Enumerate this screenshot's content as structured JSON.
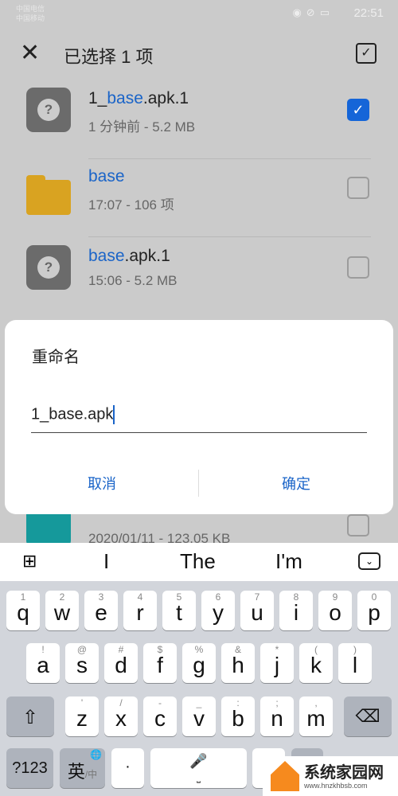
{
  "status_bar": {
    "carrier1": "中国电信",
    "carrier2": "中国移动",
    "time": "22:51",
    "icons": [
      "eye-icon",
      "mute-icon",
      "battery-icon"
    ]
  },
  "header": {
    "title": "已选择 1 项",
    "close_icon": "close-icon",
    "select_all_icon": "select-all-icon"
  },
  "files": [
    {
      "prefix": "1_",
      "highlight": "base",
      "suffix": ".apk.1",
      "meta": "1 分钟前 - 5.2 MB",
      "icon": "unknown-file-icon",
      "checked": true
    },
    {
      "prefix": "",
      "highlight": "base",
      "suffix": "",
      "meta": "17:07 - 106 项",
      "icon": "folder-icon",
      "checked": false
    },
    {
      "prefix": "",
      "highlight": "base",
      "suffix": ".apk.1",
      "meta": "15:06 - 5.2 MB",
      "icon": "unknown-file-icon",
      "checked": false
    },
    {
      "prefix": "",
      "highlight": "",
      "suffix": "",
      "meta": "2020/01/11 - 123.05 KB",
      "icon": "document-icon",
      "checked": false
    }
  ],
  "colors": {
    "accent": "#1565d8",
    "folder": "#d9a321",
    "doc": "#15999b"
  },
  "dialog": {
    "title": "重命名",
    "value": "1_base.apk",
    "cancel": "取消",
    "confirm": "确定"
  },
  "suggestions": [
    "I",
    "The",
    "I'm"
  ],
  "keyboard": {
    "row1": [
      [
        "q",
        "1"
      ],
      [
        "w",
        "2"
      ],
      [
        "e",
        "3"
      ],
      [
        "r",
        "4"
      ],
      [
        "t",
        "5"
      ],
      [
        "y",
        "6"
      ],
      [
        "u",
        "7"
      ],
      [
        "i",
        "8"
      ],
      [
        "o",
        "9"
      ],
      [
        "p",
        "0"
      ]
    ],
    "row2": [
      [
        "a",
        "!"
      ],
      [
        "s",
        "@"
      ],
      [
        "d",
        "#"
      ],
      [
        "f",
        "$"
      ],
      [
        "g",
        "%"
      ],
      [
        "h",
        "&"
      ],
      [
        "j",
        "*"
      ],
      [
        "k",
        "("
      ],
      [
        "l",
        ")"
      ]
    ],
    "row3": [
      [
        "z",
        "'"
      ],
      [
        "x",
        "/"
      ],
      [
        "c",
        "-"
      ],
      [
        "v",
        "_"
      ],
      [
        "b",
        ":"
      ],
      [
        "n",
        ";"
      ],
      [
        "m",
        ","
      ]
    ],
    "sym": "?123",
    "lang": "英",
    "lang_alt": "/中",
    "dot": "·",
    "question": "?"
  },
  "watermark": {
    "text": "系统家园网",
    "url": "www.hnzkhbsb.com"
  }
}
